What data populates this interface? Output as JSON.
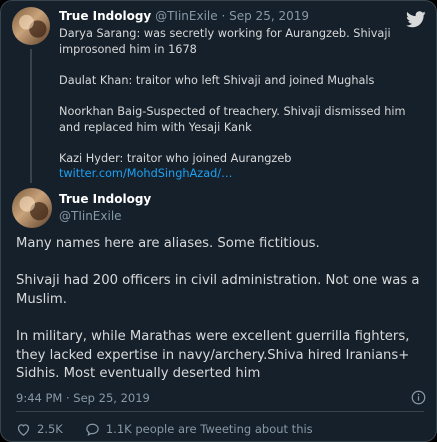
{
  "parent_tweet": {
    "display_name": "True Indology",
    "handle": "@TIinExile",
    "separator": "·",
    "date": "Sep 25, 2019",
    "paragraphs": [
      "Darya Sarang: was secretly working for Aurangzeb. Shivaji improsoned him in 1678",
      "Daulat Khan: traitor who left Shivaji and joined Mughals",
      "Noorkhan Baig-Suspected of treachery. Shivaji dismissed him and replaced him with Yesaji Kank",
      "Kazi Hyder: traitor who joined Aurangzeb"
    ],
    "link": "twitter.com/MohdSinghAzad/…"
  },
  "main_tweet": {
    "display_name": "True Indology",
    "handle": "@TIinExile",
    "paragraphs": [
      "Many names here are aliases. Some fictitious.",
      "Shivaji had 200 officers in civil administration. Not one was a Muslim.",
      "In military, while Marathas were excellent guerrilla fighters, they lacked expertise in navy/archery.Shiva hired Iranians+ Sidhis. Most eventually deserted him"
    ],
    "timestamp": "9:44 PM · Sep 25, 2019"
  },
  "actions": {
    "likes": "2.5K",
    "replies_text": "1.1K people are Tweeting about this"
  },
  "icons": {
    "logo": "twitter-bird-icon",
    "info": "info-icon",
    "like": "heart-icon",
    "reply": "reply-bubble-icon"
  },
  "colors": {
    "background": "#15202b",
    "border": "#38444d",
    "text": "#d9d9d9",
    "muted": "#8899a6",
    "link": "#1da1f2"
  }
}
